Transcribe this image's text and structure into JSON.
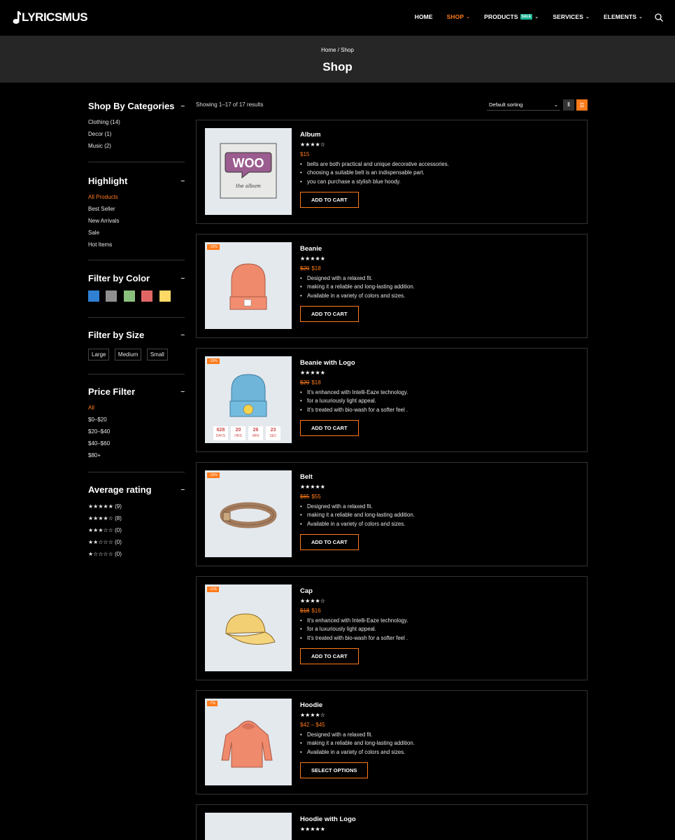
{
  "brand": {
    "name": "LYRICSMUS"
  },
  "nav": {
    "items": [
      {
        "label": "HOME",
        "active": false,
        "dropdown": false
      },
      {
        "label": "SHOP",
        "active": true,
        "dropdown": true
      },
      {
        "label": "PRODUCTS",
        "active": false,
        "dropdown": true,
        "tag": "SALE"
      },
      {
        "label": "SERVICES",
        "active": false,
        "dropdown": true
      },
      {
        "label": "ELEMENTS",
        "active": false,
        "dropdown": true
      }
    ]
  },
  "hero": {
    "breadcrumb": "Home / Shop",
    "title": "Shop"
  },
  "sidebar": {
    "categories": {
      "title": "Shop By Categories",
      "items": [
        "Clothing (14)",
        "Decor (1)",
        "Music (2)"
      ]
    },
    "highlight": {
      "title": "Highlight",
      "items": [
        "All Products",
        "Best Seller",
        "New Arrivals",
        "Sale",
        "Hot Items"
      ]
    },
    "color": {
      "title": "Filter by Color",
      "colors": [
        "#2f80d3",
        "#8f8f8f",
        "#89c07d",
        "#e06666",
        "#ffd966"
      ]
    },
    "size": {
      "title": "Filter by Size",
      "items": [
        "Large",
        "Medium",
        "Small"
      ]
    },
    "price": {
      "title": "Price Filter",
      "items": [
        "All",
        "$0–$20",
        "$20–$40",
        "$40–$60",
        "$80+"
      ]
    },
    "rating": {
      "title": "Average rating",
      "items": [
        {
          "stars": "★★★★★",
          "count": "(9)"
        },
        {
          "stars": "★★★★☆",
          "count": "(8)"
        },
        {
          "stars": "★★★☆☆",
          "count": "(0)"
        },
        {
          "stars": "★★☆☆☆",
          "count": "(0)"
        },
        {
          "stars": "★☆☆☆☆",
          "count": "(0)"
        }
      ]
    }
  },
  "toolbar": {
    "results": "Showing 1–17 of 17 results",
    "sort": "Default sorting"
  },
  "products": [
    {
      "name": "Album",
      "stars": "★★★★☆",
      "old": "",
      "price": "$15",
      "badge": "",
      "button": "ADD TO CART",
      "desc": [
        "belts are both practical and unique decorative accessories.",
        "choosing a suitable belt is an indispensable part.",
        "you can purchase a stylish blue hoody."
      ]
    },
    {
      "name": "Beanie",
      "stars": "★★★★★",
      "old": "$20",
      "price": "$18",
      "badge": "-10%",
      "button": "ADD TO CART",
      "desc": [
        "Designed with a relaxed fit.",
        "making it a reliable and long-lasting addition.",
        "Available in a variety of colors and sizes."
      ]
    },
    {
      "name": "Beanie with Logo",
      "stars": "★★★★★",
      "old": "$20",
      "price": "$18",
      "badge": "-10%",
      "button": "ADD TO CART",
      "desc": [
        "It's enhanced with Intelli-Eaze technology.",
        "for a luxuriously light appeal.",
        "It's treated with bio-wash for a softer feel ."
      ],
      "countdown": [
        {
          "n": "628",
          "l": "DAYS"
        },
        {
          "n": "20",
          "l": "HRS"
        },
        {
          "n": "26",
          "l": "MIN"
        },
        {
          "n": "23",
          "l": "SEC"
        }
      ]
    },
    {
      "name": "Belt",
      "stars": "★★★★★",
      "old": "$65",
      "price": "$55",
      "badge": "-15%",
      "button": "ADD TO CART",
      "desc": [
        "Designed with a relaxed fit.",
        "making it a reliable and long-lasting addition.",
        "Available in a variety of colors and sizes."
      ]
    },
    {
      "name": "Cap",
      "stars": "★★★★☆",
      "old": "$18",
      "price": "$16",
      "badge": "-11%",
      "button": "ADD TO CART",
      "desc": [
        "It's enhanced with Intelli-Eaze technology.",
        "for a luxuriously light appeal.",
        "It's treated with bio-wash for a softer feel ."
      ]
    },
    {
      "name": "Hoodie",
      "stars": "★★★★☆",
      "old": "",
      "price": "$42 – $45",
      "badge": "-7%",
      "button": "SELECT OPTIONS",
      "desc": [
        "Designed with a relaxed fit.",
        "making it a reliable and long-lasting addition.",
        "Available in a variety of colors and sizes."
      ]
    },
    {
      "name": "Hoodie with Logo",
      "stars": "★★★★★",
      "old": "",
      "price": "",
      "badge": "",
      "button": "",
      "desc": []
    }
  ]
}
